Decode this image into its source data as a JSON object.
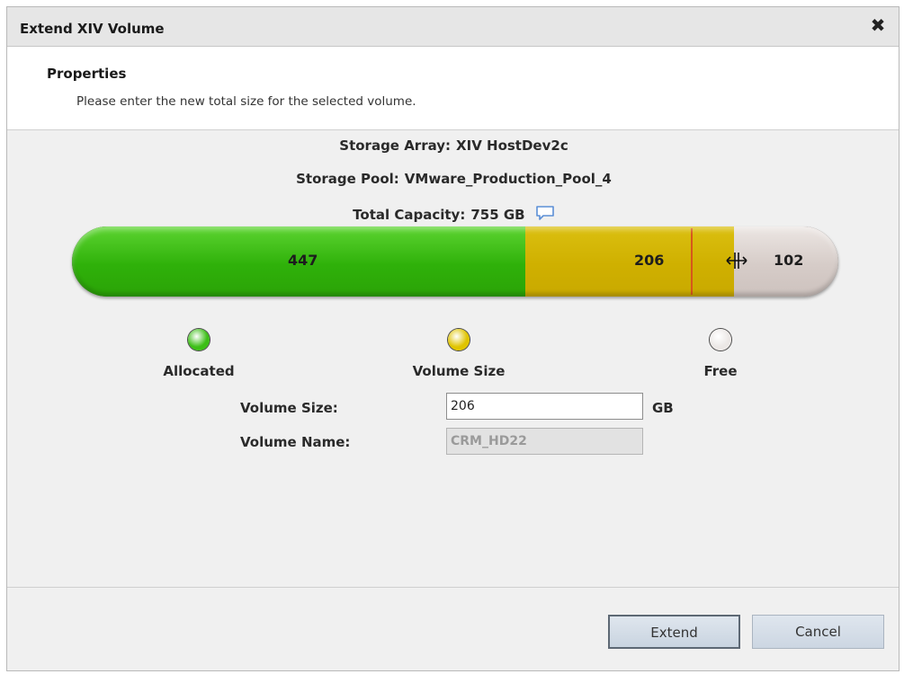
{
  "dialog": {
    "title": "Extend XIV Volume",
    "close_icon": "close-x-icon"
  },
  "properties": {
    "heading": "Properties",
    "description": "Please enter the new total size for the selected volume."
  },
  "info": {
    "storage_array_label": "Storage Array:",
    "storage_array_value": "XIV HostDev2c",
    "storage_pool_label": "Storage Pool:",
    "storage_pool_value": "VMware_Production_Pool_4",
    "total_capacity_label": "Total Capacity:",
    "total_capacity_value": "755 GB",
    "comment_icon": "comment-bubble-icon"
  },
  "capacity_bar": {
    "total": 755,
    "segments": [
      {
        "name": "allocated",
        "value": 447,
        "label": "447",
        "color": "#3cbf16"
      },
      {
        "name": "volume-size",
        "value": 206,
        "label": "206",
        "color": "#d1b200"
      },
      {
        "name": "free",
        "value": 102,
        "label": "102",
        "color": "#d6ccc8"
      }
    ],
    "marker_color": "#d6571b",
    "handle_icon": "resize-horizontal-icon"
  },
  "legend": [
    {
      "label": "Allocated",
      "color": "#3cbf16"
    },
    {
      "label": "Volume Size",
      "color": "#e0c400"
    },
    {
      "label": "Free",
      "color": "#ece8e6"
    }
  ],
  "form": {
    "volume_size_label": "Volume Size:",
    "volume_size_value": "206",
    "volume_size_unit": "GB",
    "volume_name_label": "Volume Name:",
    "volume_name_value": "CRM_HD22"
  },
  "buttons": {
    "extend": "Extend",
    "cancel": "Cancel"
  }
}
